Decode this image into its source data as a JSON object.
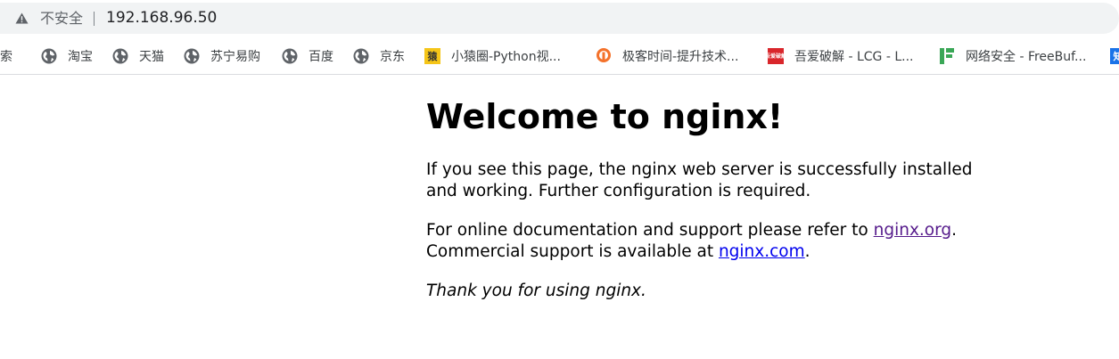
{
  "address_bar": {
    "security_label": "不安全",
    "url": "192.168.96.50"
  },
  "bookmarks": [
    {
      "label": "搜索",
      "icon": "globe-icon"
    },
    {
      "label": "淘宝",
      "icon": "globe-icon"
    },
    {
      "label": "天猫",
      "icon": "globe-icon"
    },
    {
      "label": "苏宁易购",
      "icon": "globe-icon"
    },
    {
      "label": "百度",
      "icon": "globe-icon"
    },
    {
      "label": "京东",
      "icon": "globe-icon"
    },
    {
      "label": "小猿圈-Python视...",
      "icon": "xiaoyuanquan-favicon",
      "glyph": "猿"
    },
    {
      "label": "极客时间-提升技术...",
      "icon": "geektime-favicon"
    },
    {
      "label": "吾爱破解 - LCG - L...",
      "icon": "52pojie-favicon",
      "glyph": "吾爱破解"
    },
    {
      "label": "网络安全 - FreeBuf...",
      "icon": "freebuf-favicon"
    },
    {
      "label": "",
      "icon": "zhihu-favicon",
      "glyph": "知"
    }
  ],
  "page": {
    "heading": "Welcome to nginx!",
    "intro": "If you see this page, the nginx web server is successfully installed and working. Further configuration is required.",
    "docs_prefix": "For online documentation and support please refer to ",
    "docs_link": "nginx.org",
    "docs_suffix": ".",
    "commercial_prefix": "Commercial support is available at ",
    "commercial_link": "nginx.com",
    "commercial_suffix": ".",
    "thanks": "Thank you for using nginx."
  },
  "colors": {
    "omnibox_bg": "#f1f3f4",
    "link_visited": "#551a8b",
    "link": "#0000ee"
  }
}
